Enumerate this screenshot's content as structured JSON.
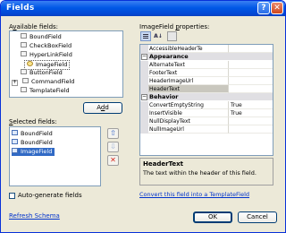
{
  "window": {
    "title": "Fields",
    "help": "?",
    "close": "✕"
  },
  "available": {
    "label": "Available fields:",
    "items": [
      {
        "label": "BoundField",
        "icon": "bound-field-icon",
        "expander": ""
      },
      {
        "label": "CheckBoxField",
        "icon": "checkbox-field-icon",
        "expander": ""
      },
      {
        "label": "HyperLinkField",
        "icon": "hyperlink-field-icon",
        "expander": ""
      },
      {
        "label": "ImageField",
        "icon": "image-field-icon",
        "expander": ""
      },
      {
        "label": "ButtonField",
        "icon": "button-field-icon",
        "expander": ""
      },
      {
        "label": "CommandField",
        "icon": "command-field-icon",
        "expander": "+"
      },
      {
        "label": "TemplateField",
        "icon": "template-field-icon",
        "expander": ""
      }
    ],
    "add_button": "Add"
  },
  "selected": {
    "label": "Selected fields:",
    "items": [
      {
        "label": "BoundField",
        "selected": false
      },
      {
        "label": "BoundField",
        "selected": false
      },
      {
        "label": "ImageField",
        "selected": true
      }
    ],
    "up": "⇧",
    "down": "⇩",
    "delete": "✕"
  },
  "autogen": {
    "label": "Auto-generate fields",
    "checked": false
  },
  "refresh_link": "Refresh Schema",
  "properties": {
    "label": "ImageField properties:",
    "rows": [
      {
        "type": "prop",
        "name": "AccessibleHeaderTe",
        "value": ""
      },
      {
        "type": "cat",
        "name": "Appearance",
        "sign": "−"
      },
      {
        "type": "prop",
        "name": "AlternateText",
        "value": ""
      },
      {
        "type": "prop",
        "name": "FooterText",
        "value": ""
      },
      {
        "type": "prop",
        "name": "HeaderImageUrl",
        "value": ""
      },
      {
        "type": "prop",
        "name": "HeaderText",
        "value": "",
        "selected": true
      },
      {
        "type": "cat",
        "name": "Behavior",
        "sign": "−"
      },
      {
        "type": "prop",
        "name": "ConvertEmptyString",
        "value": "True"
      },
      {
        "type": "prop",
        "name": "InsertVisible",
        "value": "True"
      },
      {
        "type": "prop",
        "name": "NullDisplayText",
        "value": ""
      },
      {
        "type": "prop",
        "name": "NullImageUrl",
        "value": ""
      }
    ],
    "desc_title": "HeaderText",
    "desc_text": "The text within the header of this field."
  },
  "convert_link": "Convert this field into a TemplateField",
  "ok": "OK",
  "cancel": "Cancel",
  "colors": {
    "title_bar": "#0058e6",
    "selection": "#316ac5",
    "link": "#0033cc"
  }
}
